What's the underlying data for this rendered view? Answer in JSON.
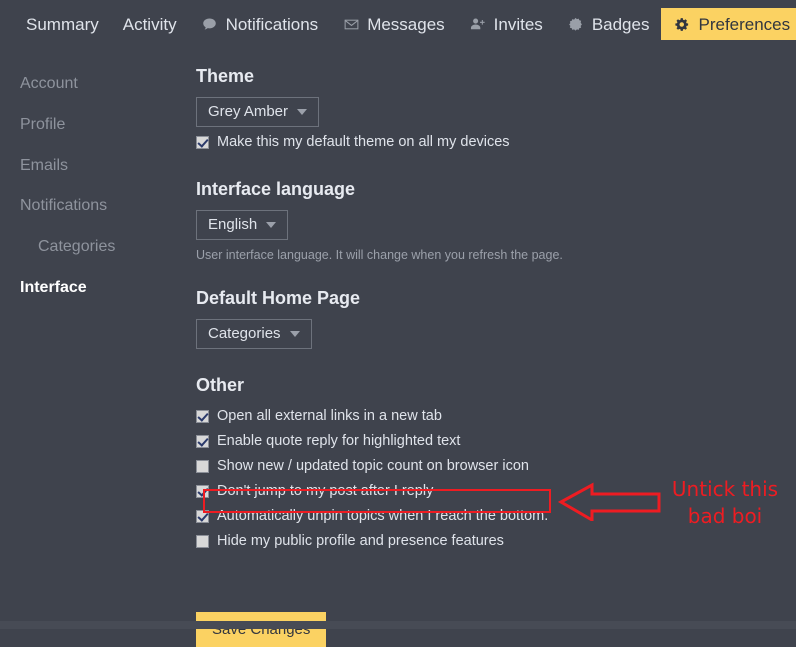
{
  "nav": {
    "items": [
      {
        "label": "Summary",
        "icon": "",
        "active": false
      },
      {
        "label": "Activity",
        "icon": "",
        "active": false
      },
      {
        "label": "Notifications",
        "icon": "speech-bubble-icon",
        "active": false
      },
      {
        "label": "Messages",
        "icon": "envelope-icon",
        "active": false
      },
      {
        "label": "Invites",
        "icon": "user-plus-icon",
        "active": false
      },
      {
        "label": "Badges",
        "icon": "badge-icon",
        "active": false
      },
      {
        "label": "Preferences",
        "icon": "gear-icon",
        "active": true
      }
    ]
  },
  "sidebar": {
    "items": [
      {
        "label": "Account",
        "sub": false,
        "active": false
      },
      {
        "label": "Profile",
        "sub": false,
        "active": false
      },
      {
        "label": "Emails",
        "sub": false,
        "active": false
      },
      {
        "label": "Notifications",
        "sub": false,
        "active": false
      },
      {
        "label": "Categories",
        "sub": true,
        "active": false
      },
      {
        "label": "Interface",
        "sub": false,
        "active": true
      }
    ]
  },
  "main": {
    "theme": {
      "heading": "Theme",
      "selected": "Grey Amber",
      "default_checkbox": {
        "label": "Make this my default theme on all my devices",
        "checked": true
      }
    },
    "language": {
      "heading": "Interface language",
      "selected": "English",
      "help": "User interface language. It will change when you refresh the page."
    },
    "home_page": {
      "heading": "Default Home Page",
      "selected": "Categories"
    },
    "other": {
      "heading": "Other",
      "options": [
        {
          "label": "Open all external links in a new tab",
          "checked": true
        },
        {
          "label": "Enable quote reply for highlighted text",
          "checked": true
        },
        {
          "label": "Show new / updated topic count on browser icon",
          "checked": false
        },
        {
          "label": "Don't jump to my post after I reply",
          "checked": true
        },
        {
          "label": "Automatically unpin topics when I reach the bottom.",
          "checked": true
        },
        {
          "label": "Hide my public profile and presence features",
          "checked": false
        }
      ]
    },
    "save_label": "Save Changes"
  },
  "annotation": {
    "text_line1": "Untick this",
    "text_line2": "bad boi",
    "color": "#ee1c22",
    "arrow_direction": "left"
  },
  "colors": {
    "background": "#3f434d",
    "accent_amber": "#fbd262",
    "text_primary": "#dfe3ea",
    "text_muted": "#8e939d",
    "annotation_red": "#ee1c22"
  }
}
